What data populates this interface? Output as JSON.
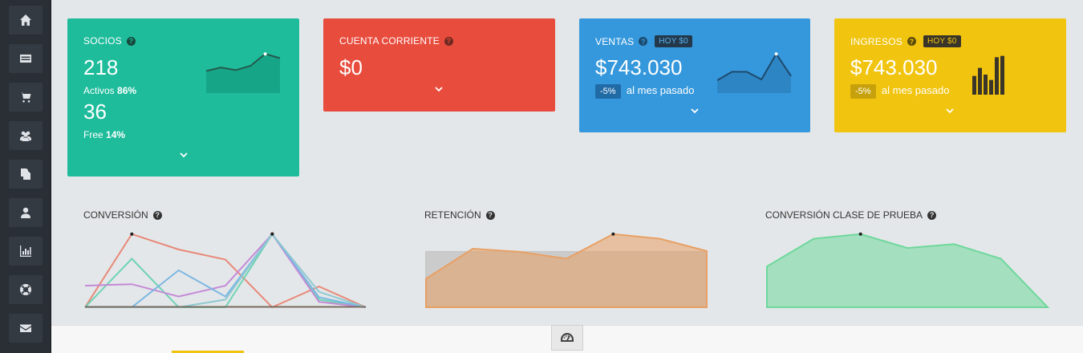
{
  "sidebar": {
    "items": [
      {
        "icon": "home-icon"
      },
      {
        "icon": "list-icon"
      },
      {
        "icon": "cart-icon"
      },
      {
        "icon": "users-icon"
      },
      {
        "icon": "documents-icon"
      },
      {
        "icon": "user-icon"
      },
      {
        "icon": "bar-chart-icon"
      },
      {
        "icon": "lifebuoy-icon"
      },
      {
        "icon": "envelope-icon"
      }
    ]
  },
  "cards": {
    "socios": {
      "title": "SOCIOS",
      "help": "?",
      "total": "218",
      "activos_label": "Activos",
      "activos_pct": "86%",
      "free_count": "36",
      "free_label": "Free",
      "free_pct": "14%",
      "color": "#1ebc9b"
    },
    "cuenta": {
      "title": "CUENTA CORRIENTE",
      "help": "?",
      "value": "$0",
      "color": "#e84c3d"
    },
    "ventas": {
      "title": "VENTAS",
      "help": "?",
      "hoy": "HOY $0",
      "value": "$743.030",
      "pct": "-5%",
      "pct_label": "al mes pasado",
      "color": "#3598dc"
    },
    "ingresos": {
      "title": "INGRESOS",
      "help": "?",
      "hoy": "HOY $0",
      "value": "$743.030",
      "pct": "-5%",
      "pct_label": "al mes pasado",
      "color": "#f1c40f"
    }
  },
  "charts": {
    "conversion": {
      "title": "CONVERSIÓN",
      "help": "?"
    },
    "retencion": {
      "title": "RETENCIÓN",
      "help": "?"
    },
    "conversion_prueba": {
      "title": "CONVERSIÓN CLASE DE PRUEBA",
      "help": "?"
    }
  },
  "chart_data": [
    {
      "type": "line",
      "series": [
        {
          "values": [
            0,
            95,
            75,
            62,
            0,
            27,
            0
          ],
          "color": "#e8897a"
        },
        {
          "values": [
            0,
            63,
            0,
            0,
            95,
            10,
            0
          ],
          "color": "#6fd3b4"
        },
        {
          "values": [
            28,
            30,
            14,
            28,
            95,
            7,
            0
          ],
          "color": "#c48ad7"
        },
        {
          "values": [
            0,
            0,
            48,
            14,
            95,
            13,
            0
          ],
          "color": "#7cb7e3"
        },
        {
          "values": [
            0,
            0,
            0,
            10,
            95,
            20,
            0
          ],
          "color": "#8fc8d0"
        }
      ]
    },
    {
      "type": "area",
      "series": [
        {
          "values": [
            72,
            72,
            72,
            72,
            72,
            72,
            72
          ],
          "color": "#c8c8c8"
        },
        {
          "values": [
            37,
            76,
            72,
            63,
            95,
            89,
            73
          ],
          "color": "#e8a065"
        }
      ]
    },
    {
      "type": "area",
      "series": [
        {
          "values": [
            53,
            89,
            95,
            77,
            82,
            63,
            0
          ],
          "color": "#6fd89c"
        }
      ]
    }
  ],
  "sparklines": {
    "socios": [
      26,
      30,
      27,
      32,
      46,
      41
    ],
    "ventas": [
      15,
      25,
      25,
      16,
      46,
      20
    ],
    "ingresos_bars": [
      14,
      20,
      15,
      11,
      28,
      29
    ]
  },
  "footer": {
    "icon": "gauge-icon"
  }
}
